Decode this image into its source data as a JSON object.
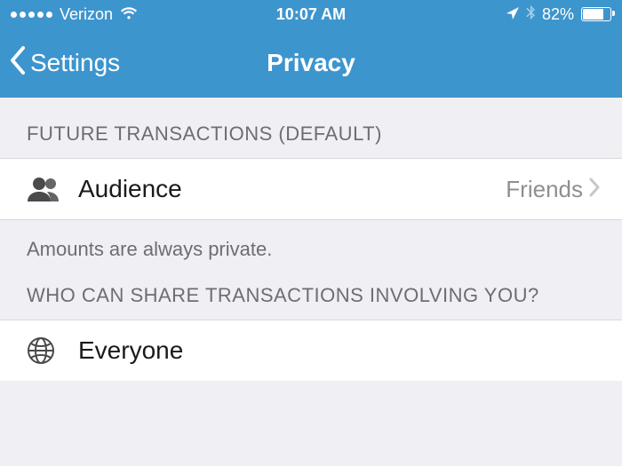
{
  "status": {
    "carrier": "Verizon",
    "time": "10:07 AM",
    "battery_pct": "82%",
    "battery_fill_pct": 82
  },
  "nav": {
    "back_label": "Settings",
    "title": "Privacy"
  },
  "sections": {
    "future_header": "FUTURE TRANSACTIONS (DEFAULT)",
    "audience": {
      "label": "Audience",
      "value": "Friends"
    },
    "amounts_note": "Amounts are always private.",
    "share_header": "WHO CAN SHARE TRANSACTIONS INVOLVING YOU?",
    "everyone": {
      "label": "Everyone"
    }
  }
}
